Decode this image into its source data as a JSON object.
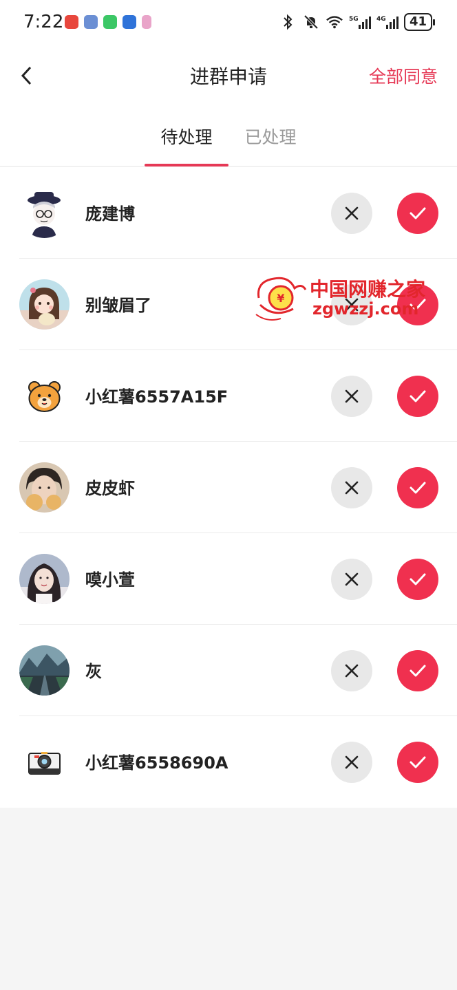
{
  "status_bar": {
    "time": "7:22",
    "battery": "41",
    "network_1": "5G",
    "network_2": "4G"
  },
  "nav": {
    "title": "进群申请",
    "action": "全部同意",
    "accent_color": "#e63956"
  },
  "tabs": [
    {
      "label": "待处理",
      "active": true
    },
    {
      "label": "已处理",
      "active": false
    }
  ],
  "requests": [
    {
      "name": "庞建博",
      "avatar": "cartoon-hat-avatar"
    },
    {
      "name": "别皱眉了",
      "avatar": "girl-illustration-avatar"
    },
    {
      "name": "小红薯6557A15F",
      "avatar": "bear-avatar"
    },
    {
      "name": "皮皮虾",
      "avatar": "photo-avatar"
    },
    {
      "name": "嗼小萱",
      "avatar": "photo-avatar"
    },
    {
      "name": "灰",
      "avatar": "landscape-avatar"
    },
    {
      "name": "小红薯6558690A",
      "avatar": "camera-avatar"
    }
  ],
  "watermark": {
    "line1": "中国网赚之家",
    "line2": "zgwzzj.com"
  }
}
